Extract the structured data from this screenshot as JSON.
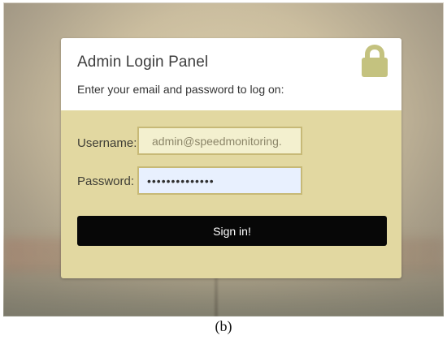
{
  "login_panel": {
    "title": "Admin Login Panel",
    "subtitle": "Enter your email and password to log on:",
    "lock_icon": "lock-icon",
    "username_label": "Username:",
    "username_value": "admin@speedmonitoring.",
    "password_label": "Password:",
    "password_value": "••••••••••••••",
    "sign_in_label": "Sign in!"
  },
  "figure": {
    "caption": "(b)"
  },
  "colors": {
    "panel_body": "#e2d8a1",
    "panel_header": "#ffffff",
    "lock_icon": "#c4c27f",
    "password_field_background": "#e8f0fe",
    "button_background": "#070707",
    "button_text": "#ffffff"
  }
}
